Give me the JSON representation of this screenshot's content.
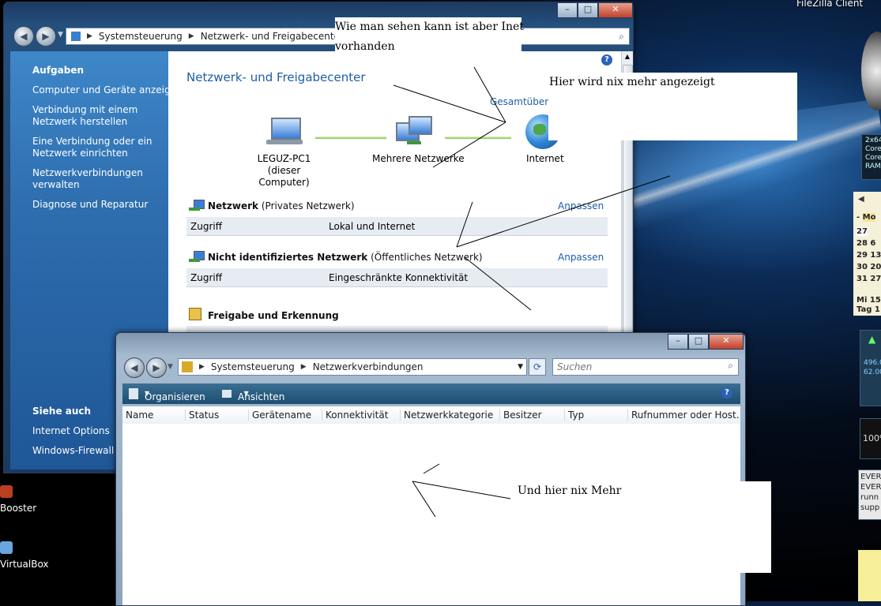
{
  "desktop": {
    "top_right_label": "FileZilla Client",
    "icons": [
      {
        "label": "Booster"
      },
      {
        "label": "VirtualBox"
      }
    ],
    "gadget_sys": [
      "2x64",
      "Core",
      "Core",
      "RAM"
    ],
    "calendar": {
      "header": "Mo",
      "rows": [
        [
          "27",
          ""
        ],
        [
          "28",
          "6"
        ],
        [
          "29",
          "13"
        ],
        [
          "30",
          "20"
        ],
        [
          "31",
          "27"
        ]
      ],
      "footer": [
        "Mi 15",
        "Tag 1"
      ]
    },
    "meter": {
      "value1": "496.0",
      "value2": "62.00"
    },
    "percent": "100%",
    "everest": [
      "EVER",
      "EVER",
      "runn",
      "supp"
    ]
  },
  "window1": {
    "address": {
      "crumbs": [
        "Systemsteuerung",
        "Netzwerk- und Freigabecenter"
      ]
    },
    "sidebar": {
      "tasks_title": "Aufgaben",
      "tasks": [
        "Computer und Geräte anzeigen",
        "Verbindung mit einem\nNetzwerk herstellen",
        "Eine Verbindung oder ein\nNetzwerk einrichten",
        "Netzwerkverbindungen\nverwalten",
        "Diagnose und Reparatur"
      ],
      "see_also_title": "Siehe auch",
      "see_also": [
        "Internet Options",
        "Windows-Firewall"
      ]
    },
    "content": {
      "title": "Netzwerk- und Freigabecenter",
      "overview_link": "Gesamtübersic",
      "map": {
        "pc_name": "LEGUZ-PC1",
        "pc_sub": "(dieser Computer)",
        "middle": "Mehrere Netzwerke",
        "internet": "Internet"
      },
      "networks": [
        {
          "name": "Netzwerk",
          "type": "(Privates Netzwerk)",
          "customize": "Anpassen",
          "access_label": "Zugriff",
          "access_value": "Lokal und Internet"
        },
        {
          "name": "Nicht identifiziertes Netzwerk",
          "type": "(Öffentliches Netzwerk)",
          "customize": "Anpassen",
          "access_label": "Zugriff",
          "access_value": "Eingeschränkte Konnektivität"
        }
      ],
      "sharing_title": "Freigabe und Erkennung"
    }
  },
  "window2": {
    "address": {
      "crumbs": [
        "Systemsteuerung",
        "Netzwerkverbindungen"
      ]
    },
    "search_placeholder": "Suchen",
    "toolbar": {
      "organize": "Organisieren",
      "views": "Ansichten"
    },
    "columns": [
      "Name",
      "Status",
      "Gerätename",
      "Konnektivität",
      "Netzwerkkategorie",
      "Besitzer",
      "Typ",
      "Rufnummer oder Host..."
    ]
  },
  "annotations": {
    "note1": "Wie man sehen kann ist aber Inet\nvorhanden",
    "note2": "Hier wird nix mehr angezeigt",
    "note3": "Und hier nix Mehr"
  },
  "colors": {
    "link": "#1e5ea8",
    "sidebar": "#2d6cad",
    "close_button": "#c2412b"
  }
}
